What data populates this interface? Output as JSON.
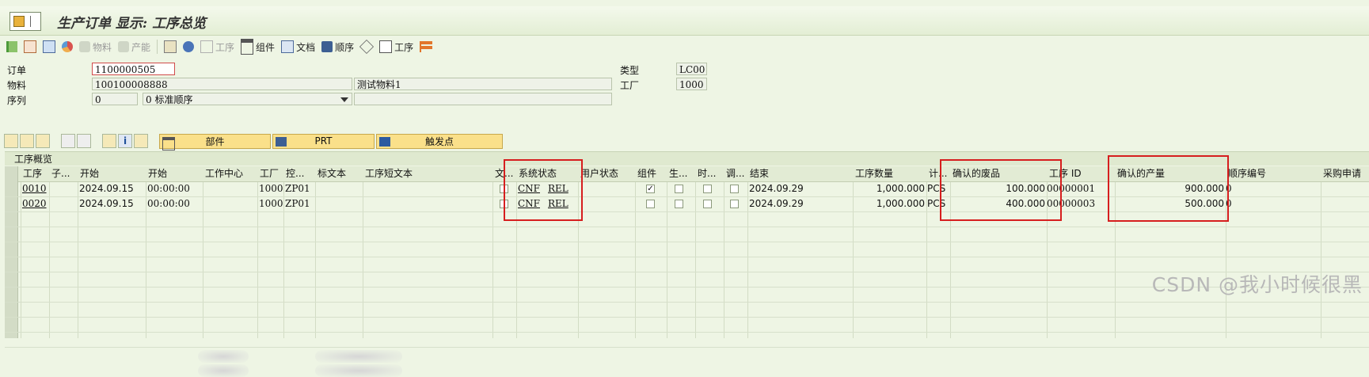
{
  "window": {
    "title": "生产订单 显示: 工序总览"
  },
  "toolbar": {
    "material_label": "物料",
    "capacity_label": "产能",
    "operation_label": "工序",
    "component_label": "组件",
    "document_label": "文档",
    "sequence_label": "顺序",
    "operation2_label": "工序"
  },
  "header": {
    "order_label": "订单",
    "order_value": "1100000505",
    "material_label": "物料",
    "material_value": "100100008888",
    "material_desc": "测试物料1",
    "sequence_label": "序列",
    "sequence_value": "0",
    "sequence_desc": "0 标准顺序",
    "type_label": "类型",
    "type_value": "LC00",
    "plant_label": "工厂",
    "plant_value": "1000"
  },
  "buttons": {
    "parts": "部件",
    "prt": "PRT",
    "trigger": "触发点"
  },
  "grid": {
    "title": "工序概览",
    "columns": [
      "工序",
      "子...",
      "开始",
      "开始",
      "工作中心",
      "工厂",
      "控...",
      "标文本",
      "工序短文本",
      "文...",
      "系统状态",
      "用户状态",
      "组件",
      "生...",
      "时...",
      "调...",
      "结束",
      "工序数量",
      "计...",
      "确认的废品",
      "工序 ID",
      "确认的产量",
      "顺序编号",
      "采购申请"
    ],
    "rows": [
      {
        "op": "0010",
        "start_date": "2024.09.15",
        "start_time": "00:00:00",
        "plant": "1000",
        "ctrl": "ZP01",
        "status": "CNF",
        "status2": "REL",
        "component_checked": true,
        "end_date": "2024.09.29",
        "qty": "1,000.000",
        "unit": "PCS",
        "scrap": "100.000",
        "op_id": "00000001",
        "yield": "900.000",
        "seq_no": "0"
      },
      {
        "op": "0020",
        "start_date": "2024.09.15",
        "start_time": "00:00:00",
        "plant": "1000",
        "ctrl": "ZP01",
        "status": "CNF",
        "status2": "REL",
        "component_checked": false,
        "end_date": "2024.09.29",
        "qty": "1,000.000",
        "unit": "PCS",
        "scrap": "400.000",
        "op_id": "00000003",
        "yield": "500.000",
        "seq_no": "0"
      }
    ]
  },
  "watermark": "CSDN @我小时候很黑",
  "colors": {
    "highlight_box": "#d61e1e",
    "button_yellow": "#fae08a",
    "background": "#eef5e4"
  }
}
